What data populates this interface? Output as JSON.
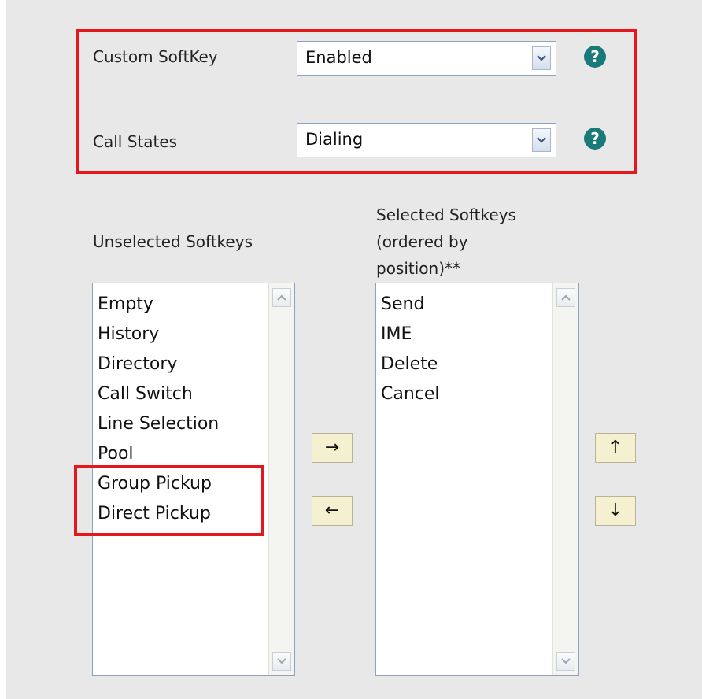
{
  "custom_softkey": {
    "label": "Custom SoftKey",
    "value": "Enabled"
  },
  "call_states": {
    "label": "Call States",
    "value": "Dialing"
  },
  "help_icon": "?",
  "unselected": {
    "heading": "Unselected Softkeys",
    "items": [
      "Empty",
      "History",
      "Directory",
      "Call Switch",
      "Line Selection",
      "Pool",
      "Group Pickup",
      "Direct Pickup"
    ]
  },
  "selected": {
    "heading_line1": "Selected Softkeys",
    "heading_line2": "(ordered by",
    "heading_line3": "position)**",
    "items": [
      "Send",
      "IME",
      "Delete",
      "Cancel"
    ]
  },
  "buttons": {
    "move_right": "→",
    "move_left": "←",
    "move_up": "↑",
    "move_down": "↓"
  },
  "colors": {
    "highlight_box": "#e5161c",
    "help_icon_bg": "#1a7a7a",
    "panel_bg": "#e8e8e8"
  }
}
